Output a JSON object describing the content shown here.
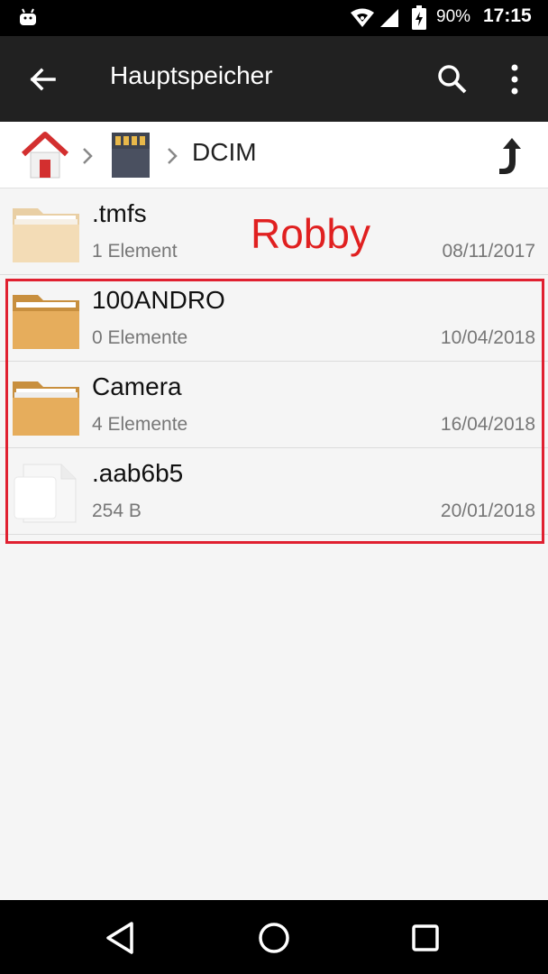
{
  "status_bar": {
    "battery": "90%",
    "time": "17:15"
  },
  "app_bar": {
    "title": "Hauptspeicher"
  },
  "breadcrumb": {
    "current": "DCIM"
  },
  "watermark": "Robby",
  "files": [
    {
      "name": ".tmfs",
      "meta": "1 Element",
      "date": "08/11/2017",
      "icon": "folder-icon"
    },
    {
      "name": "100ANDRO",
      "meta": "0 Elemente",
      "date": "10/04/2018",
      "icon": "folder-icon"
    },
    {
      "name": "Camera",
      "meta": "4 Elemente",
      "date": "16/04/2018",
      "icon": "folder-icon"
    },
    {
      "name": ".aab6b5",
      "meta": "254 B",
      "date": "20/01/2018",
      "icon": "file-icon"
    }
  ],
  "colors": {
    "app_bar": "#212121",
    "highlight": "#e02030",
    "watermark": "#e02020"
  }
}
